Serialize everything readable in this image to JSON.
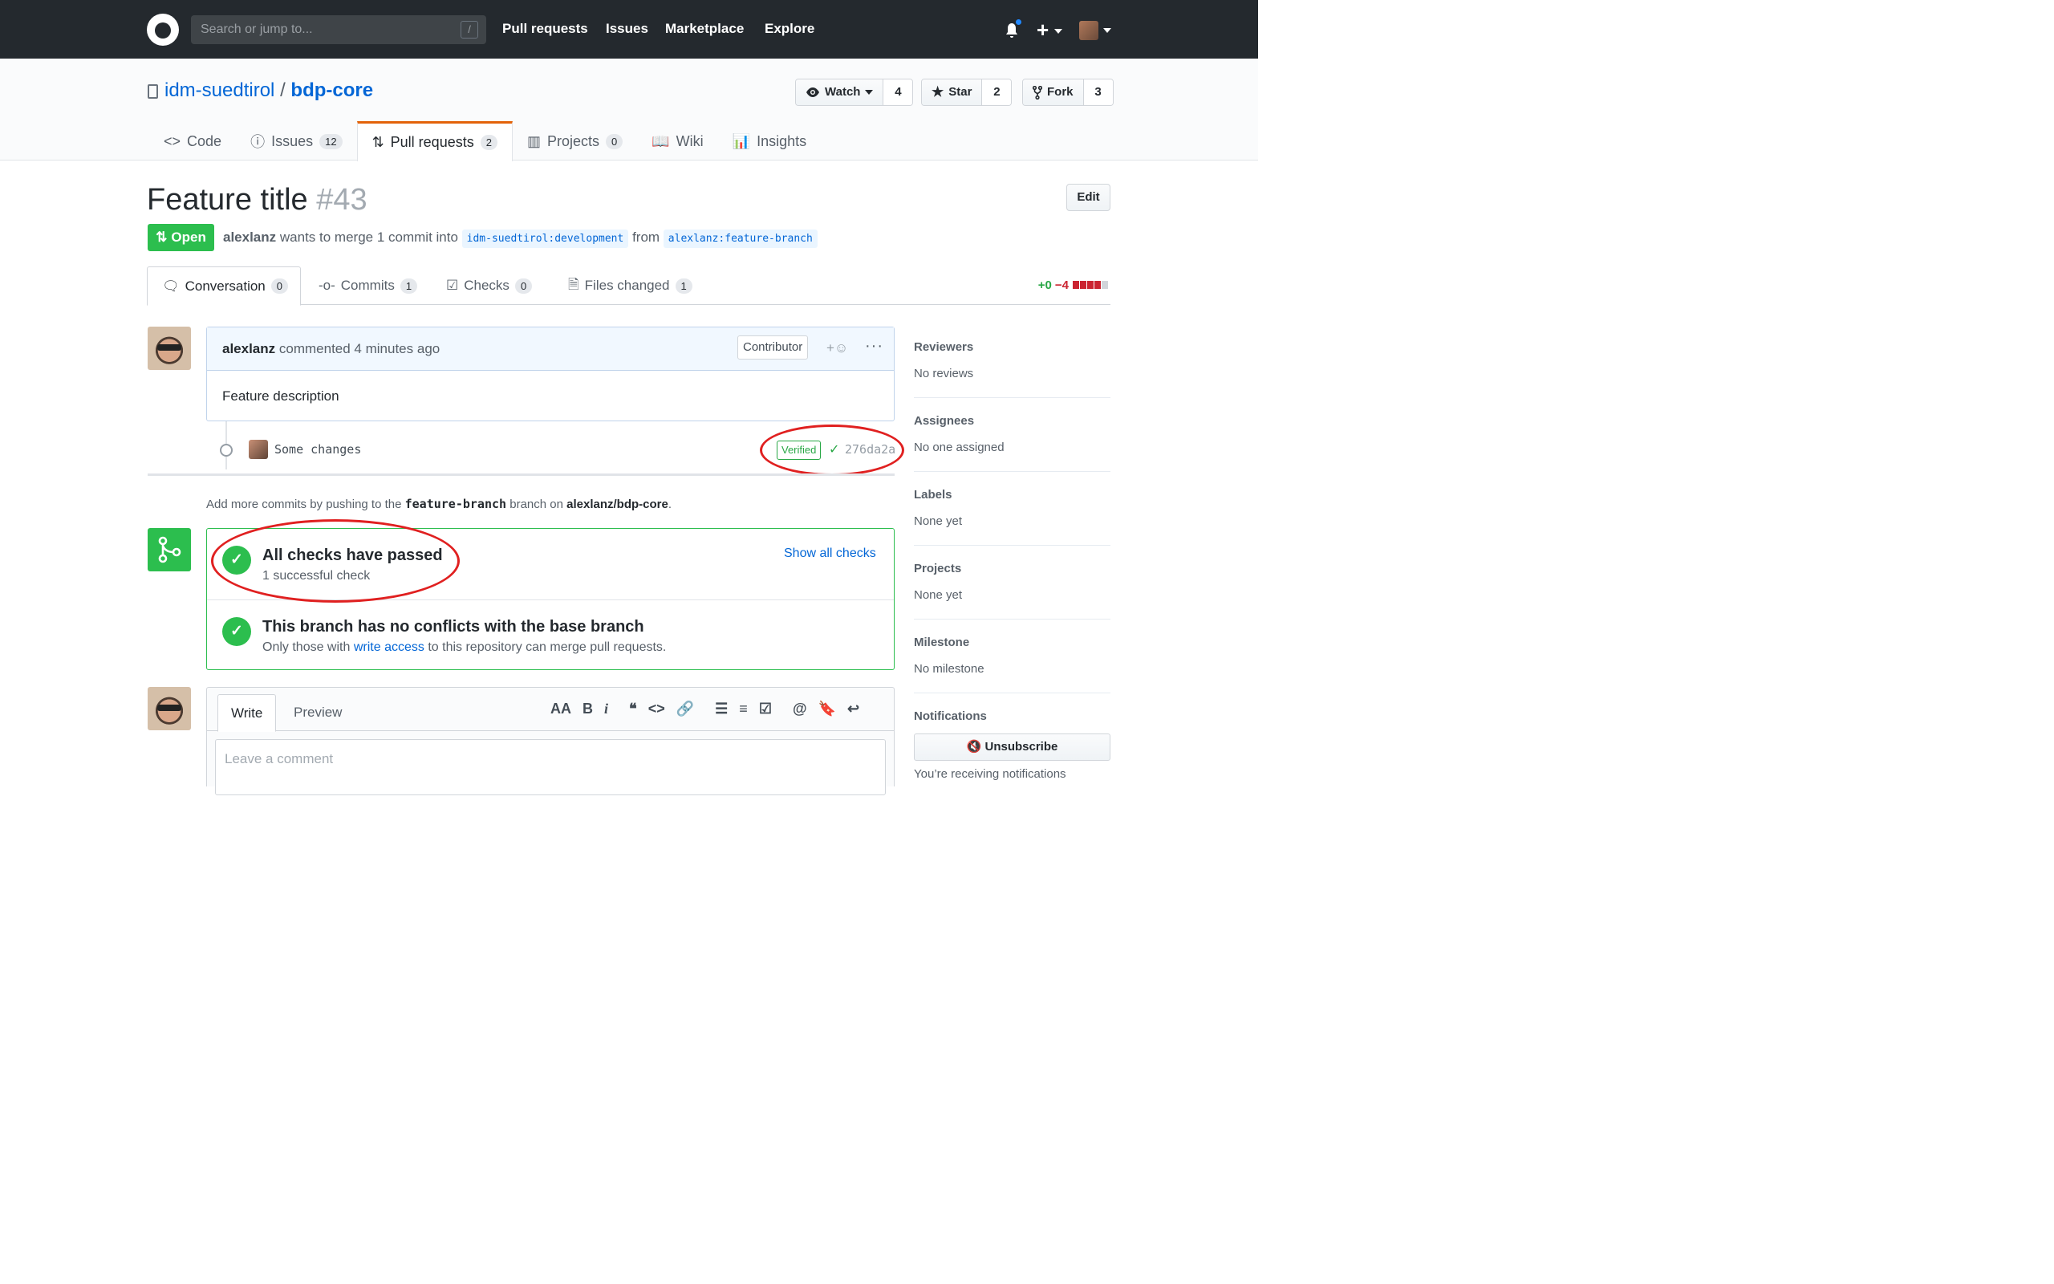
{
  "header": {
    "search_placeholder": "Search or jump to...",
    "search_shortcut": "/",
    "nav": [
      "Pull requests",
      "Issues",
      "Marketplace",
      "Explore"
    ],
    "plus": "+"
  },
  "repo": {
    "owner": "idm-suedtirol",
    "separator": "/",
    "name": "bdp-core",
    "watch_label": "Watch",
    "watch_count": "4",
    "star_label": "Star",
    "star_count": "2",
    "fork_label": "Fork",
    "fork_count": "3",
    "tabs": [
      {
        "label": "Code",
        "count": ""
      },
      {
        "label": "Issues",
        "count": "12"
      },
      {
        "label": "Pull requests",
        "count": "2"
      },
      {
        "label": "Projects",
        "count": "0"
      },
      {
        "label": "Wiki",
        "count": ""
      },
      {
        "label": "Insights",
        "count": ""
      }
    ]
  },
  "pr": {
    "title": "Feature title",
    "number": "#43",
    "edit_label": "Edit",
    "state": "Open",
    "author": "alexlanz",
    "merge_text": "wants to merge 1 commit into",
    "base_ref": "idm-suedtirol:development",
    "from_text": "from",
    "head_ref": "alexlanz:feature-branch",
    "tabs": [
      {
        "label": "Conversation",
        "count": "0"
      },
      {
        "label": "Commits",
        "count": "1"
      },
      {
        "label": "Checks",
        "count": "0"
      },
      {
        "label": "Files changed",
        "count": "1"
      }
    ],
    "additions": "+0",
    "deletions": "−4"
  },
  "comment": {
    "author": "alexlanz",
    "action": "commented 4 minutes ago",
    "badge": "Contributor",
    "reaction": "+☺",
    "menu": "···",
    "body": "Feature description"
  },
  "commit": {
    "message": "Some changes",
    "verified": "Verified",
    "check": "✓",
    "sha": "276da2a"
  },
  "push_note": {
    "prefix": "Add more commits by pushing to the",
    "branch": "feature-branch",
    "middle": "branch on",
    "repo": "alexlanz/bdp-core",
    "suffix": "."
  },
  "merge": {
    "checks_title": "All checks have passed",
    "checks_sub": "1 successful check",
    "show_all": "Show all checks",
    "conflict_title": "This branch has no conflicts with the base branch",
    "conflict_prefix": "Only those with",
    "conflict_link": "write access",
    "conflict_suffix": "to this repository can merge pull requests."
  },
  "composer": {
    "write_tab": "Write",
    "preview_tab": "Preview",
    "placeholder": "Leave a comment",
    "toolbar": [
      "AA",
      "B",
      "i",
      "❝",
      "<>",
      "🔗",
      "☰",
      "≡",
      "☑",
      "@",
      "🔖",
      "↩"
    ]
  },
  "sidebar": {
    "sections": [
      {
        "title": "Reviewers",
        "value": "No reviews"
      },
      {
        "title": "Assignees",
        "value": "No one assigned"
      },
      {
        "title": "Labels",
        "value": "None yet"
      },
      {
        "title": "Projects",
        "value": "None yet"
      },
      {
        "title": "Milestone",
        "value": "No milestone"
      }
    ],
    "notifications_title": "Notifications",
    "unsubscribe": "Unsubscribe",
    "receiving": "You’re receiving notifications"
  },
  "colors": {
    "open_green": "#2cbe4e",
    "link_blue": "#0366d6",
    "annotation_red": "#e02020"
  }
}
